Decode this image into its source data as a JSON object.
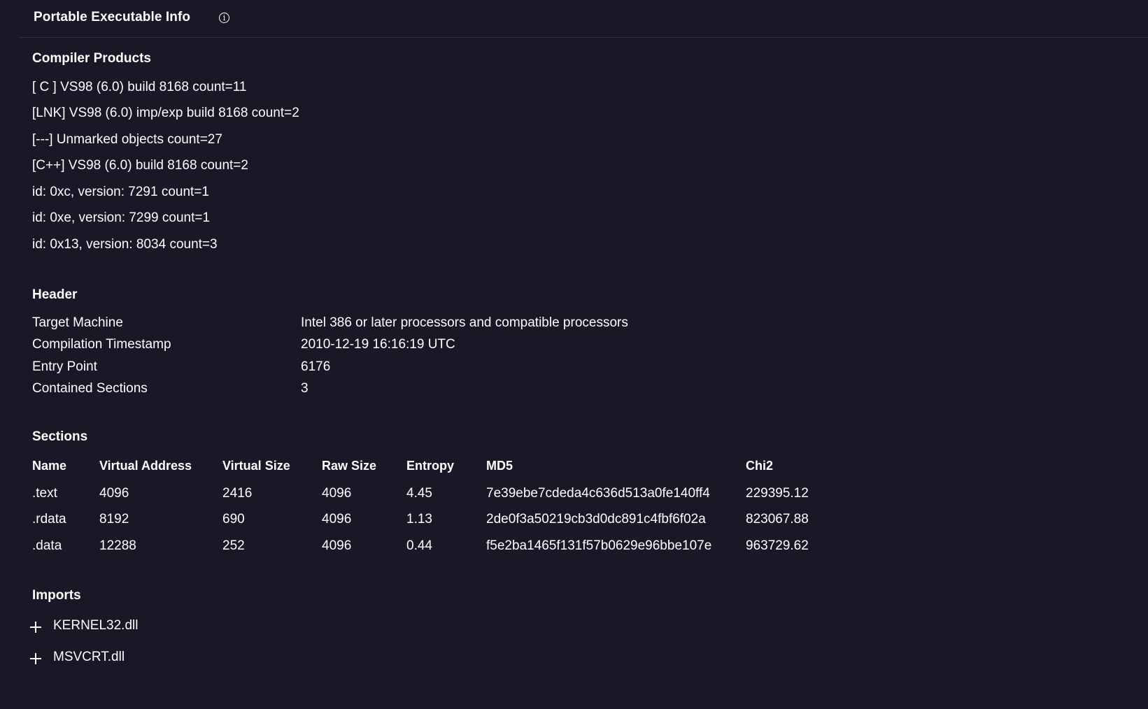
{
  "panel": {
    "title": "Portable Executable Info",
    "info_icon": "i"
  },
  "compiler": {
    "heading": "Compiler Products",
    "items": [
      "[ C ] VS98 (6.0) build 8168 count=11",
      "[LNK] VS98 (6.0) imp/exp build 8168 count=2",
      "[---] Unmarked objects count=27",
      "[C++] VS98 (6.0) build 8168 count=2",
      "id: 0xc, version: 7291 count=1",
      "id: 0xe, version: 7299 count=1",
      "id: 0x13, version: 8034 count=3"
    ]
  },
  "header": {
    "heading": "Header",
    "rows": [
      {
        "key": "Target Machine",
        "value": "Intel 386 or later processors and compatible processors"
      },
      {
        "key": "Compilation Timestamp",
        "value": "2010-12-19 16:16:19 UTC"
      },
      {
        "key": "Entry Point",
        "value": "6176"
      },
      {
        "key": "Contained Sections",
        "value": "3"
      }
    ]
  },
  "sections": {
    "heading": "Sections",
    "columns": [
      "Name",
      "Virtual Address",
      "Virtual Size",
      "Raw Size",
      "Entropy",
      "MD5",
      "Chi2"
    ],
    "rows": [
      [
        ".text",
        "4096",
        "2416",
        "4096",
        "4.45",
        "7e39ebe7cdeda4c636d513a0fe140ff4",
        "229395.12"
      ],
      [
        ".rdata",
        "8192",
        "690",
        "4096",
        "1.13",
        "2de0f3a50219cb3d0dc891c4fbf6f02a",
        "823067.88"
      ],
      [
        ".data",
        "12288",
        "252",
        "4096",
        "0.44",
        "f5e2ba1465f131f57b0629e96bbe107e",
        "963729.62"
      ]
    ]
  },
  "imports": {
    "heading": "Imports",
    "items": [
      "KERNEL32.dll",
      "MSVCRT.dll"
    ]
  }
}
